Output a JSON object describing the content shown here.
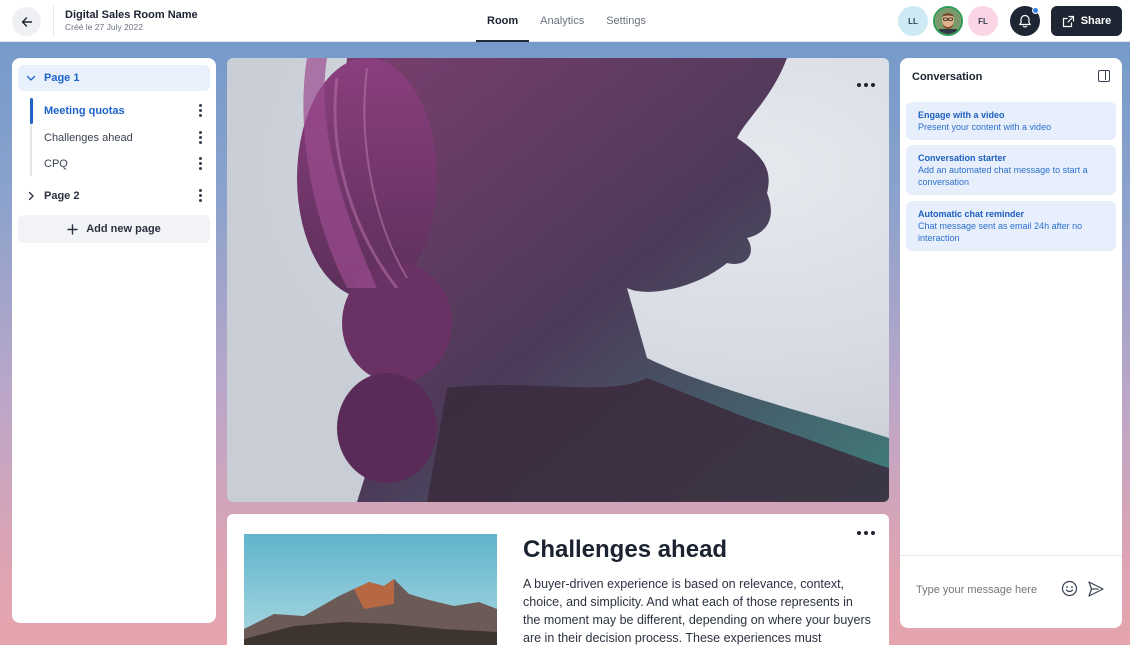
{
  "header": {
    "title": "Digital Sales Room Name",
    "subtitle": "Créé le 27 July 2022",
    "tabs": [
      {
        "label": "Room",
        "active": true
      },
      {
        "label": "Analytics",
        "active": false
      },
      {
        "label": "Settings",
        "active": false
      }
    ],
    "avatars": [
      {
        "initials": "LL",
        "color": "#cdeaf4"
      },
      {
        "initials": "",
        "color": "#f0c9a0",
        "ring": "#2a9d55"
      },
      {
        "initials": "FL",
        "color": "#fbd5e6"
      }
    ],
    "notification_dot_color": "#2f7fe6",
    "share_label": "Share"
  },
  "sidebar": {
    "pages": [
      {
        "label": "Page 1",
        "expanded": true,
        "sections": [
          {
            "label": "Meeting quotas",
            "active": true
          },
          {
            "label": "Challenges ahead",
            "active": false
          },
          {
            "label": "CPQ",
            "active": false
          }
        ]
      },
      {
        "label": "Page 2",
        "expanded": false
      }
    ],
    "add_page_label": "Add new page"
  },
  "content": {
    "section_title": "Challenges ahead",
    "section_body": "A buyer-driven experience is based on relevance, context, choice, and simplicity. And what each of those represents in the moment may be different, depending on where your buyers are in their decision process. These experiences must"
  },
  "conversation": {
    "title": "Conversation",
    "suggestions": [
      {
        "title": "Engage with a video",
        "description": "Present your content with a video"
      },
      {
        "title": "Conversation starter",
        "description": "Add an automated chat message to start a conversation"
      },
      {
        "title": "Automatic chat reminder",
        "description": "Chat message sent as email 24h after no interaction"
      }
    ],
    "input_placeholder": "Type your message here"
  },
  "colors": {
    "accent": "#1e63c9",
    "dark": "#1e2633",
    "suggestion_bg": "#e6effb"
  }
}
